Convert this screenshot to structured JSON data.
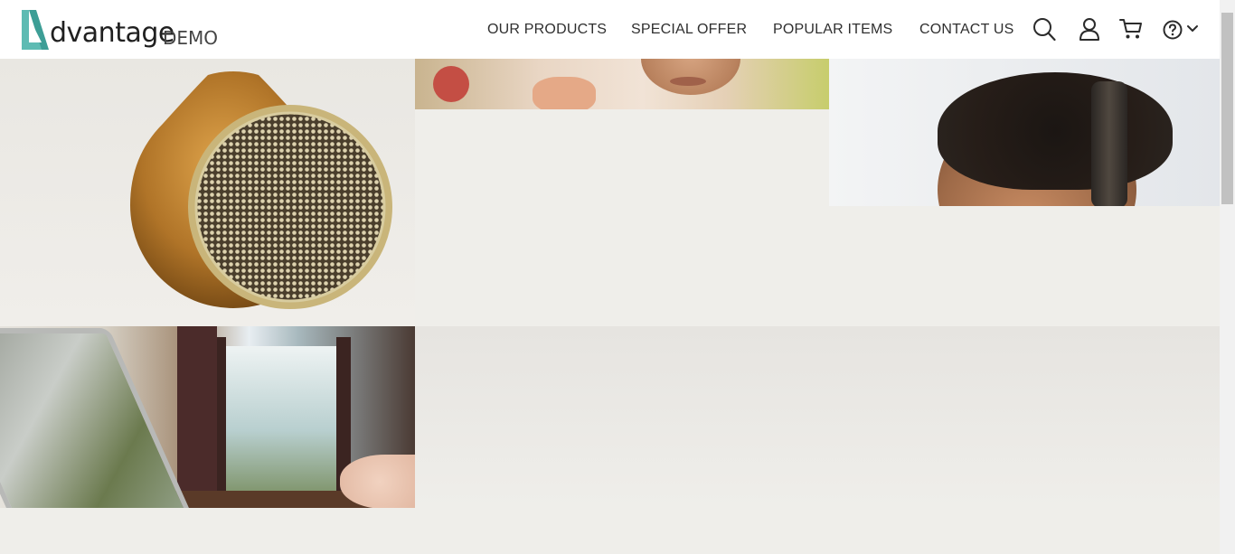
{
  "brand": {
    "name": "dvantage",
    "suffix": "DEMO",
    "accent_color": "#5ebbb3"
  },
  "nav": {
    "items": [
      {
        "label": "OUR PRODUCTS"
      },
      {
        "label": "SPECIAL OFFER"
      },
      {
        "label": "POPULAR ITEMS"
      },
      {
        "label": "CONTACT US"
      }
    ]
  },
  "header_icons": [
    {
      "name": "search-icon"
    },
    {
      "name": "user-icon"
    },
    {
      "name": "cart-icon"
    },
    {
      "name": "help-icon"
    },
    {
      "name": "chevron-down-icon"
    }
  ],
  "tiles": [
    {
      "name": "speaker-tile"
    },
    {
      "name": "woman-tile"
    },
    {
      "name": "man-headphones-tile"
    },
    {
      "name": "tablet-tile"
    }
  ]
}
